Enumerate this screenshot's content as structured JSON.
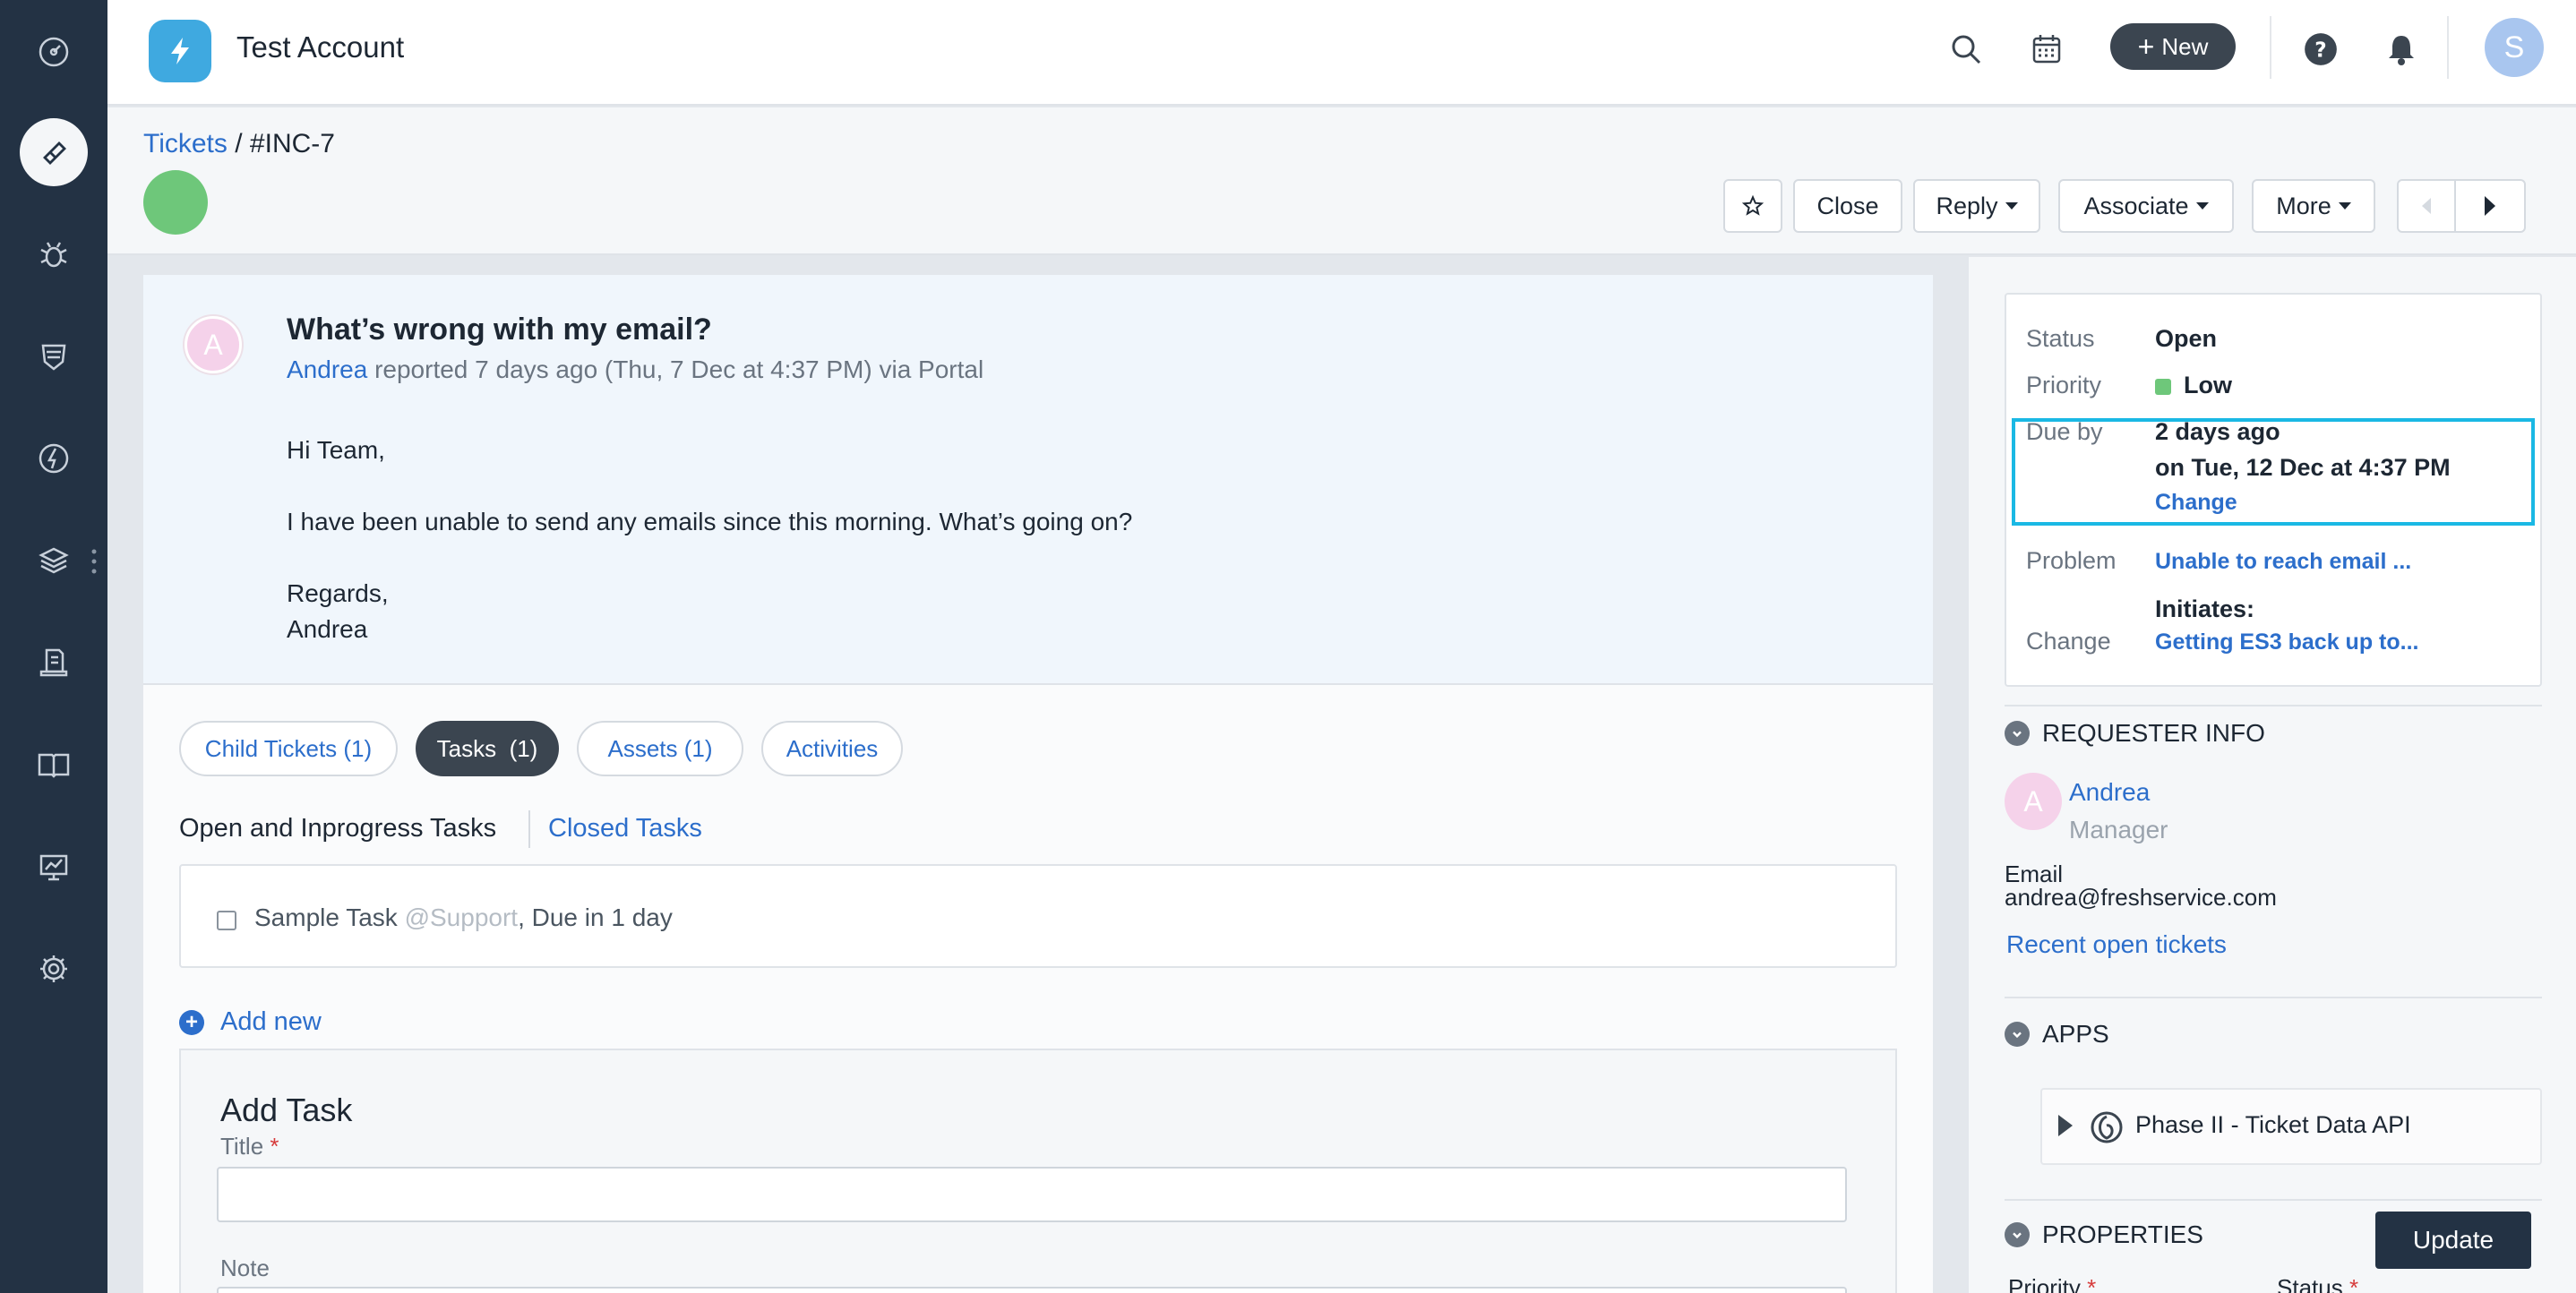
{
  "header": {
    "account_name": "Test Account",
    "new_label": "New",
    "avatar_initial": "S"
  },
  "breadcrumb": {
    "root": "Tickets",
    "separator": " / ",
    "current": "#INC-7"
  },
  "toolbar": {
    "close_label": "Close",
    "reply_label": "Reply",
    "associate_label": "Associate",
    "more_label": "More"
  },
  "ticket": {
    "title": "What’s wrong with my email?",
    "requester": "Andrea",
    "meta": " reported 7 days ago (Thu, 7 Dec at 4:37 PM) via Portal",
    "avatar_initial": "A",
    "body": [
      "Hi Team,",
      "I have been unable to send any emails since this morning. What’s going on?",
      "Regards,",
      "Andrea"
    ]
  },
  "tabs": [
    {
      "label": "Child Tickets (1)",
      "active": false
    },
    {
      "label": "Tasks  (1)",
      "active": true
    },
    {
      "label": "Assets (1)",
      "active": false
    },
    {
      "label": "Activities",
      "active": false
    }
  ],
  "tasks": {
    "open_tab": "Open and Inprogress Tasks",
    "closed_tab": "Closed Tasks",
    "item_title": "Sample Task",
    "item_assignee": " @Support",
    "item_due": ", Due in 1 day",
    "add_new_label": "Add new",
    "form_title": "Add Task",
    "title_label": "Title",
    "note_label": "Note",
    "required_mark": "*"
  },
  "properties_card": {
    "status_label": "Status",
    "status_value": "Open",
    "priority_label": "Priority",
    "priority_value": "Low",
    "due_label": "Due by",
    "due_relative": "2 days ago",
    "due_absolute": "on Tue, 12 Dec at 4:37 PM",
    "due_change": "Change",
    "problem_label": "Problem",
    "problem_value": "Unable to reach email ...",
    "initiates_label": "Initiates:",
    "change_label": "Change",
    "change_value": "Getting ES3 back up to..."
  },
  "requester_info": {
    "heading": "REQUESTER INFO",
    "avatar_initial": "A",
    "name": "Andrea",
    "role": "Manager",
    "email_label": "Email",
    "email": "andrea@freshservice.com",
    "recent_link": "Recent open tickets"
  },
  "apps": {
    "heading": "APPS",
    "item": "Phase II - Ticket Data API"
  },
  "properties": {
    "heading": "PROPERTIES",
    "priority_label": "Priority",
    "status_label": "Status",
    "update_label": "Update"
  },
  "colors": {
    "sidebar": "#233244",
    "accent": "#2c6ecb",
    "highlight": "#1ab8e4",
    "priority_low": "#6ec77a"
  }
}
